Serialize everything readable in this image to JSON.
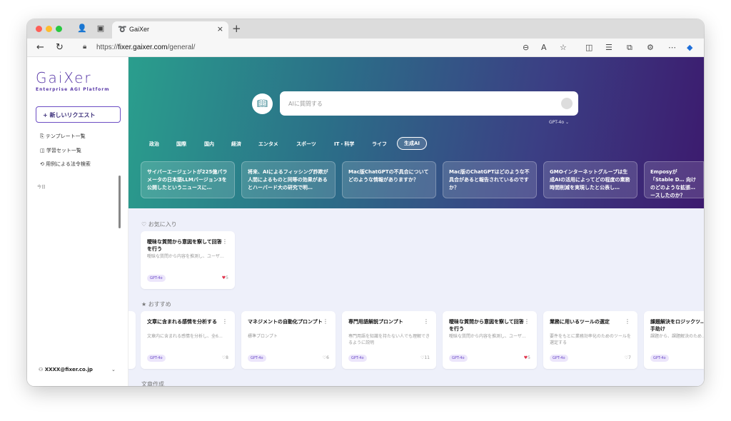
{
  "browser": {
    "tab_title": "GaiXer",
    "new_tab": "+",
    "url_prefix": "https://",
    "url_host": "fixer.gaixer.com",
    "url_path": "/general/"
  },
  "sidebar": {
    "logo": "GaiXer",
    "logo_subtitle": "Enterprise AGI Platform",
    "new_request": "+ 新しいリクエスト",
    "links": [
      "テンプレート一覧",
      "学習セット一覧",
      "用例による法令検索"
    ],
    "today": "今日",
    "user": "XXXX@fixer.co.jp"
  },
  "hero": {
    "search_placeholder": "AIに質問する",
    "model": "GPT-4o  ⌄",
    "categories": [
      "政治",
      "国際",
      "国内",
      "経済",
      "エンタメ",
      "スポーツ",
      "IT・科学",
      "ライフ",
      "生成AI"
    ],
    "active_category": "生成AI",
    "news": [
      "サイバーエージェントが225億パラメータの日本語LLMバージョン3を公開したというニュースに…",
      "将来、AIによるフィッシング詐欺が人間によるものと同等の効果があるとハーバード大の研究で明…",
      "Mac版ChatGPTの不具合についてどのような情報がありますか？",
      "Mac版のChatGPTはどのような不具合があると報告されているのですか？",
      "GMOインターネットグループは生成AIの活用によってどの程度の業務時間削減を実現したと公表し…",
      "Emposyが「Stable D… 向けのどのような拡張… ースしたのか？"
    ]
  },
  "favorites": {
    "title": "♡ お気に入り",
    "cards": [
      {
        "title": "曖昧な質問から意図を察して回答を行う",
        "desc": "曖昧な質問から内容を推測し、ユーザ…",
        "tag": "GPT-4o",
        "likes": "5",
        "liked": true
      }
    ]
  },
  "recommended": {
    "title": "★ おすすめ",
    "cards": [
      {
        "title": "文章に含まれる感情を分析する",
        "desc": "文章内に含まれる感情を分析し、全6…",
        "tag": "GPT-4o",
        "likes": "8",
        "liked": false
      },
      {
        "title": "マネジメントの自動化プロンプト",
        "desc": "標準プロンプト",
        "tag": "GPT-4o",
        "likes": "6",
        "liked": false
      },
      {
        "title": "専門用語解説プロンプト",
        "desc": "専門用語を知識を持たない人でも理解できるように説明",
        "tag": "GPT-4o",
        "likes": "11",
        "liked": false
      },
      {
        "title": "曖昧な質問から意図を察して回答を行う",
        "desc": "曖昧な質問から内容を推測し、ユーザ…",
        "tag": "GPT-4o",
        "likes": "5",
        "liked": true
      },
      {
        "title": "業務に用いるツールの選定",
        "desc": "要件をもとに業務効率化のためのツールを選定する",
        "tag": "GPT-4o",
        "likes": "7",
        "liked": false
      },
      {
        "title": "課題解決をロジックツ… 用いて手助け",
        "desc": "課題から、課題解決のため…",
        "tag": "GPT-4o",
        "likes": "",
        "liked": false
      }
    ]
  },
  "next_section": "文章作成"
}
